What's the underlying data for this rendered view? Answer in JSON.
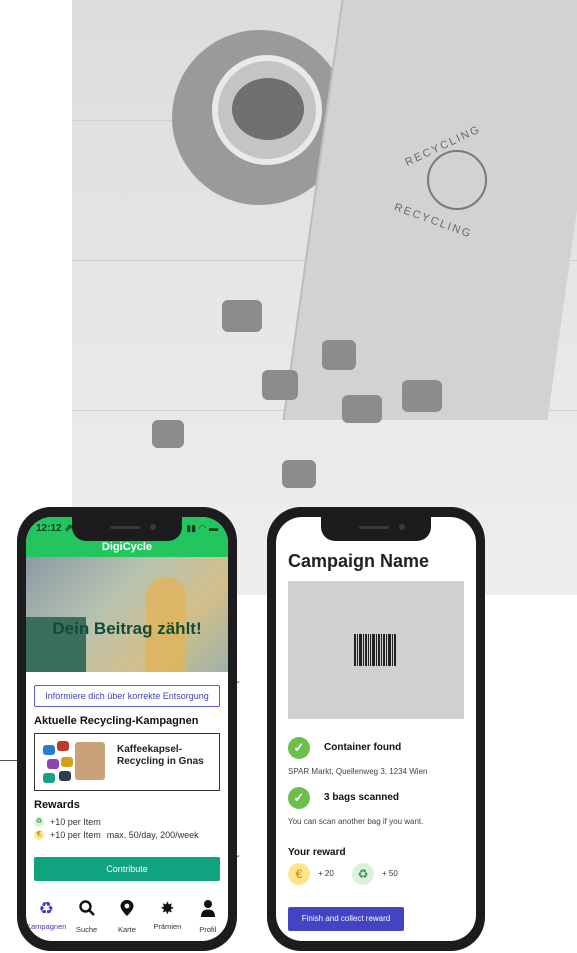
{
  "background": {
    "bag_text_1": "RECYCLING",
    "bag_text_2": "RECYCLING"
  },
  "left_phone": {
    "status_time": "12:12 ⇗",
    "status_icons": "▮▮ ◠ ▬",
    "brand": "DigiCycle",
    "hero_title": "Dein Beitrag zählt!",
    "info_button": "Informiere dich über korrekte Entsorgung",
    "section_title": "Aktuelle Recycling-Kampagnen",
    "campaign_card": {
      "title": "Kaffeekapsel-Recycling in Gnas"
    },
    "rewards": {
      "title": "Rewards",
      "row_1": "+10 per Item",
      "row_2": "+10 per Item",
      "limit": "max. 50/day, 200/week"
    },
    "contribute_button": "Contribute",
    "nav": [
      {
        "label": "Kampagnen",
        "icon": "recycle-icon"
      },
      {
        "label": "Suche",
        "icon": "search-icon"
      },
      {
        "label": "Karte",
        "icon": "map-pin-icon"
      },
      {
        "label": "Prämien",
        "icon": "badge-icon"
      },
      {
        "label": "Profil",
        "icon": "user-icon"
      }
    ]
  },
  "right_phone": {
    "title": "Campaign Name",
    "container_found": "Container found",
    "location": "SPAR Markt, Quellenweg 3, 1234 Wien",
    "bags_scanned": "3 bags scanned",
    "scan_hint": "You can scan another bag if you want.",
    "reward_title": "Your reward",
    "reward_euro": "+ 20",
    "reward_recycle": "+ 50",
    "finish_button": "Finish and collect reward"
  },
  "colors": {
    "brand_green": "#22c55e",
    "contribute_teal": "#10a37f",
    "finish_indigo": "#4343c4",
    "check_green": "#6cc04a"
  }
}
